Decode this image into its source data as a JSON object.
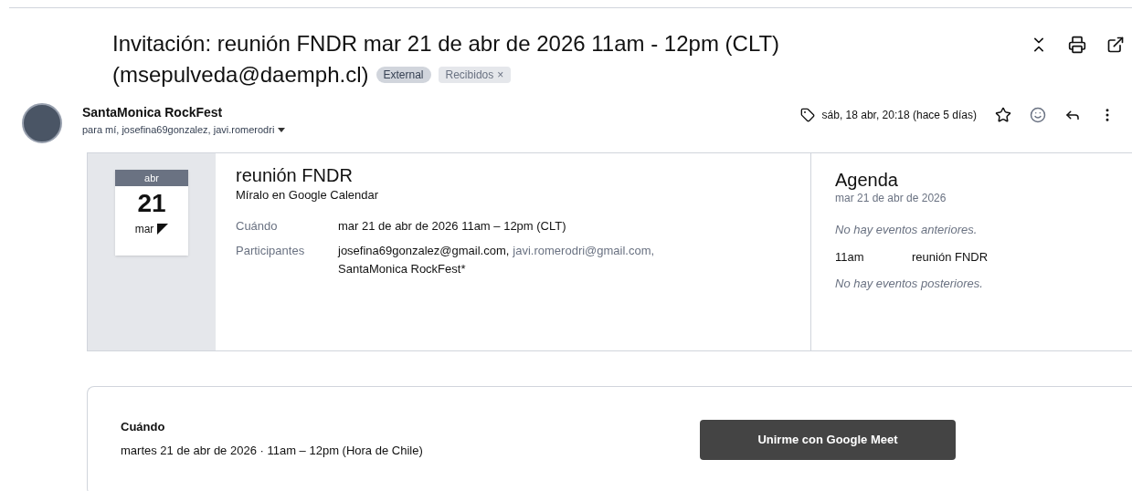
{
  "subject": {
    "lines": [
      "Invitación: reunión FNDR mar 21 de abr de 2026 11am - 12pm (CLT)",
      "(msepulveda@daemph.cl)"
    ],
    "labels": [
      {
        "text": "External",
        "removable": false
      },
      {
        "text": "Recibidos",
        "removable": true,
        "remove_glyph": "×"
      }
    ]
  },
  "message": {
    "sender": "SantaMonica RockFest",
    "recipients": "para mí, josefina69gonzalez, javi.romerodri",
    "date": "sáb, 18 abr, 20:18 (hace 5 días)",
    "starred": false
  },
  "invite": {
    "calendar": {
      "month": "abr",
      "day": "21",
      "weekday": "mar"
    },
    "title": "reunión FNDR",
    "link": "Míralo en Google Calendar",
    "fields": [
      {
        "label": "Cuándo",
        "values": [
          "mar 21 de abr de 2026 11am – 12pm (CLT)"
        ]
      },
      {
        "label": "Participantes",
        "values": [
          "josefina69gonzalez@gmail.com,",
          "javi.romerodri@gmail.com,",
          "SantaMonica RockFest*"
        ]
      }
    ],
    "agenda": {
      "title": "Agenda",
      "date": "mar 21 de abr de 2026",
      "before": "No hay eventos anteriores.",
      "events": [
        {
          "time": "11am",
          "title": "reunión FNDR"
        }
      ],
      "after": "No hay eventos posteriores."
    }
  },
  "details": {
    "label": "Cuándo",
    "value": "martes 21 de abr de 2026 · 11am – 12pm (Hora de Chile)",
    "button": "Unirme con Google Meet"
  }
}
